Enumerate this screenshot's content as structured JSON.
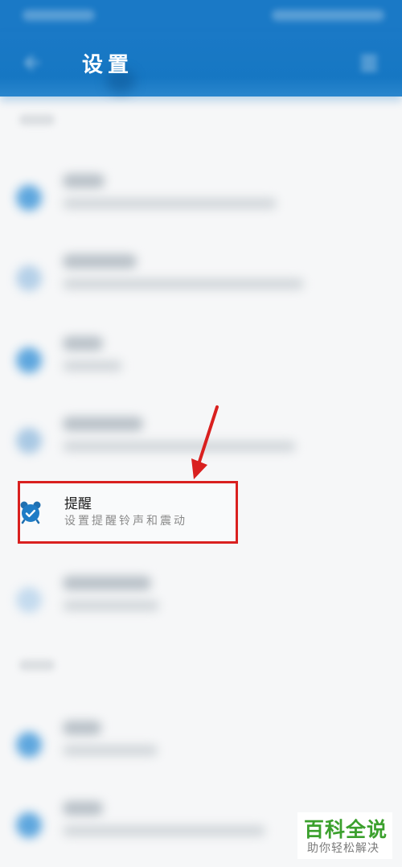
{
  "header": {
    "title": "设置",
    "back_icon": "back-arrow-icon",
    "more_icon": "more-icon"
  },
  "highlighted_item": {
    "title": "提醒",
    "subtitle": "设置提醒铃声和震动",
    "icon": "alarm-clock-icon"
  },
  "watermark": {
    "title": "百科全说",
    "subtitle": "助你轻松解决"
  },
  "colors": {
    "header": "#1a79c6",
    "accent": "#2a8bd5",
    "highlight_border": "#d9201f",
    "watermark_green": "#3ba02d"
  }
}
